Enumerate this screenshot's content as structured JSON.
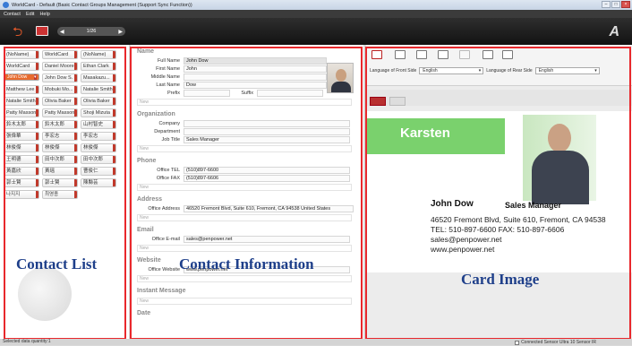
{
  "window": {
    "title": "WorldCard - Default (Basic Contact Groups Management (Support Sync Function))"
  },
  "menu": [
    "Contact",
    "Edit",
    "Help"
  ],
  "pager": {
    "label": "1/26"
  },
  "contacts": [
    [
      "(NoName)",
      "WorldCard",
      "(NoName)"
    ],
    [
      "WorldCard",
      "Daniel Moore",
      "Ethan Clark"
    ],
    [
      "John Dow",
      "John Dow S.",
      "Masakazu..."
    ],
    [
      "Matthew Lee",
      "Mobuki Mo...",
      "Natalie Smith"
    ],
    [
      "Natalie Smith",
      "Olivia Baker",
      "Olivia Baker"
    ],
    [
      "Patty Masson",
      "Patty Masson",
      "Shoji Mizuta"
    ],
    [
      "鈴木太郎",
      "鈴木太郎",
      "山村智史"
    ],
    [
      "張偉華",
      "李宏志",
      "李宏志"
    ],
    [
      "林俊傑",
      "林俊傑",
      "林俊傑"
    ],
    [
      "王明德",
      "田中次郎",
      "田中次郎"
    ],
    [
      "黃嘉欣",
      "黃瑶",
      "曹俊仁"
    ],
    [
      "郭士賢",
      "郭士賢",
      "陳縣芸"
    ],
    [
      "나지지",
      "최영종",
      ""
    ]
  ],
  "selected_contact": "John Dow",
  "name": {
    "heading": "Name",
    "full_name_label": "Full Name",
    "full_name": "John Dow",
    "first_name_label": "First Name",
    "first_name": "John",
    "middle_name_label": "Middle Name",
    "middle_name": "",
    "last_name_label": "Last Name",
    "last_name": "Dow",
    "prefix_label": "Prefix",
    "suffix_label": "Suffix"
  },
  "new_placeholder": "New",
  "organization": {
    "heading": "Organization",
    "company_label": "Company",
    "department_label": "Department",
    "job_title_label": "Job Title",
    "job_title": "Sales Manager"
  },
  "phone": {
    "heading": "Phone",
    "tel_label": "Office TEL",
    "tel": "(510)897-6600",
    "fax_label": "Office FAX",
    "fax": "(510)897-6606"
  },
  "address": {
    "heading": "Address",
    "label": "Office Address",
    "value": "46520 Fremont Blvd, Suite 610, Fremont, CA 94538 United States"
  },
  "email": {
    "heading": "Email",
    "label": "Office E-mail",
    "value": "sales@penpower.net"
  },
  "website": {
    "heading": "Website",
    "label": "Office Website",
    "value": "www.penpower.net"
  },
  "instant_message": {
    "heading": "Instant Message"
  },
  "date": {
    "heading": "Date"
  },
  "card_settings": {
    "front_label": "Language of Front Side",
    "front_value": "English",
    "rear_label": "Language of Rear Side",
    "rear_value": "English"
  },
  "card": {
    "logo": "Karsten",
    "name": "John Dow",
    "title": "Sales Manager",
    "address": "46520 Fremont Blvd, Suite 610, Fremont, CA 94538",
    "phones": "TEL: 510-897-6600     FAX: 510-897-6606",
    "email": "sales@penpower.net",
    "web": "www.penpower.net"
  },
  "overlays": {
    "contact_list": "Contact List",
    "contact_info": "Contact Information",
    "card_image": "Card Image"
  },
  "status": {
    "left": "Selected data quantity:1",
    "right": "Connected Sensor Ultra 10 Sensor IR"
  }
}
